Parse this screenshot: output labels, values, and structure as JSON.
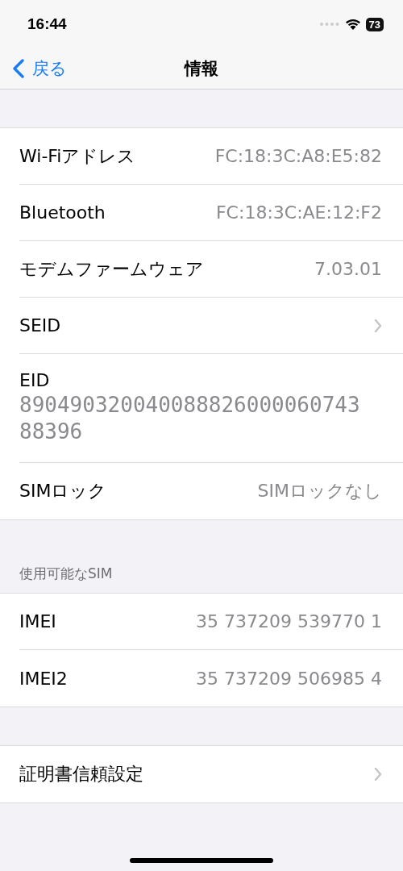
{
  "status_bar": {
    "time": "16:44",
    "battery": "73"
  },
  "nav": {
    "back": "戻る",
    "title": "情報"
  },
  "sections": [
    {
      "rows": [
        {
          "kind": "value",
          "label": "Wi-Fiアドレス",
          "value": "FC:18:3C:A8:E5:82"
        },
        {
          "kind": "value",
          "label": "Bluetooth",
          "value": "FC:18:3C:AE:12:F2"
        },
        {
          "kind": "value",
          "label": "モデムファームウェア",
          "value": "7.03.01"
        },
        {
          "kind": "chevron",
          "label": "SEID"
        },
        {
          "kind": "stacked",
          "label": "EID",
          "value": "89049032004008882600006074388396"
        },
        {
          "kind": "value",
          "label": "SIMロック",
          "value": "SIMロックなし"
        }
      ]
    },
    {
      "header": "使用可能なSIM",
      "rows": [
        {
          "kind": "value",
          "label": "IMEI",
          "value": "35 737209 539770 1"
        },
        {
          "kind": "value",
          "label": "IMEI2",
          "value": "35 737209 506985 4"
        }
      ]
    },
    {
      "rows": [
        {
          "kind": "chevron",
          "label": "証明書信頼設定"
        }
      ]
    }
  ]
}
